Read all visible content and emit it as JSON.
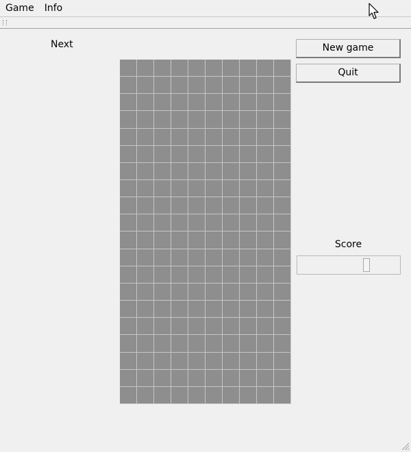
{
  "menu": {
    "items": [
      "Game",
      "Info"
    ]
  },
  "sidebar": {
    "next_label": "Next"
  },
  "board": {
    "columns": 10,
    "rows": 20,
    "cell_color": "#8e8e8e",
    "grid_line_color": "#c6c6c6"
  },
  "controls": {
    "new_game_label": "New game",
    "quit_label": "Quit",
    "score_label": "Score"
  },
  "icons": {
    "cursor": "mouse-pointer-icon",
    "grip": "toolbar-grip-icon",
    "resize": "resize-grip-icon"
  }
}
